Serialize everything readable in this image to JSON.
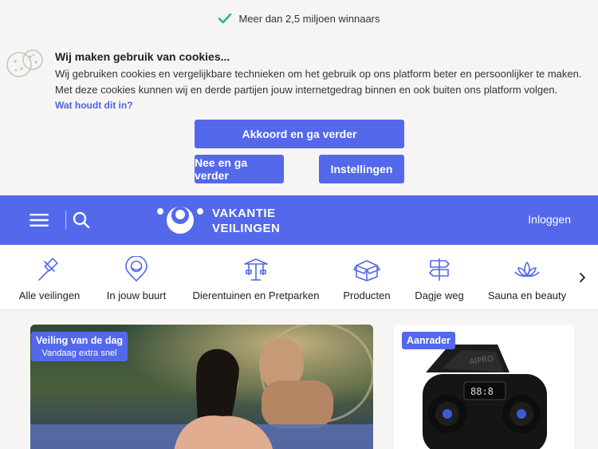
{
  "topbar": {
    "check_icon": "check-icon",
    "text": "Meer dan 2,5 miljoen winnaars"
  },
  "cookie": {
    "icon": "cookie-icon",
    "title": "Wij maken gebruik van cookies...",
    "text": "Wij gebruiken cookies en vergelijkbare technieken om het gebruik op ons platform beter en persoonlijker te maken. Met deze cookies kunnen wij en derde partijen jouw internetgedrag binnen en ook buiten ons platform volgen.",
    "link": "Wat houdt dit in?",
    "accept_label": "Akkoord en ga verder",
    "decline_label": "Nee en ga verder",
    "settings_label": "Instellingen"
  },
  "header": {
    "logo_line1": "VAKANTIE",
    "logo_line2": "VEILINGEN",
    "login_label": "Inloggen",
    "brand_color": "#5468ec"
  },
  "categories": [
    {
      "label": "Alle veilingen",
      "icon": "gavel-icon"
    },
    {
      "label": "In jouw buurt",
      "icon": "location-pin-icon"
    },
    {
      "label": "Dierentuinen en Pretparken",
      "icon": "carousel-icon"
    },
    {
      "label": "Producten",
      "icon": "box-icon"
    },
    {
      "label": "Dagje weg",
      "icon": "signpost-icon"
    },
    {
      "label": "Sauna en beauty",
      "icon": "lotus-icon"
    }
  ],
  "cards": [
    {
      "badge_title": "Veiling van de dag",
      "badge_sub": "Vandaag extra snel"
    },
    {
      "badge_title": "Aanrader"
    }
  ]
}
